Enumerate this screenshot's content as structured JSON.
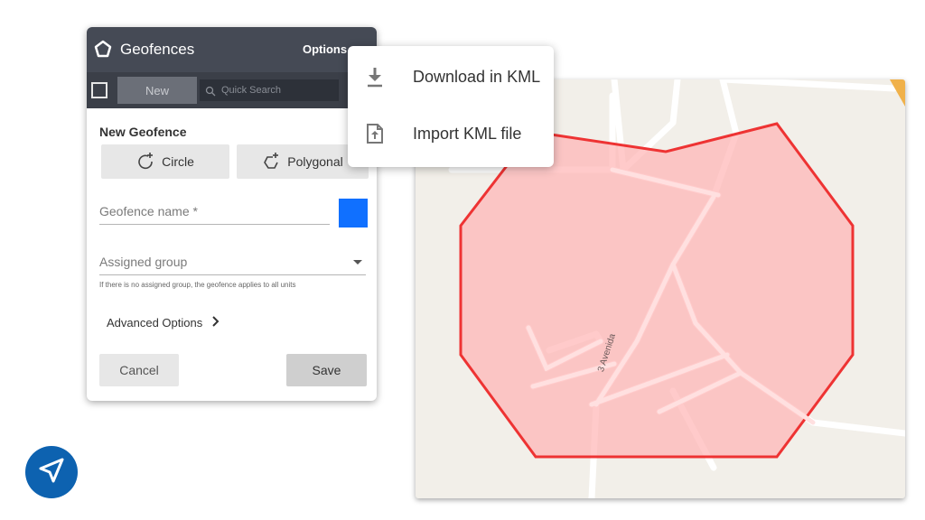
{
  "panel": {
    "title": "Geofences",
    "options_label": "Options",
    "new_label": "New",
    "search_placeholder": "Quick Search",
    "section_title": "New Geofence",
    "circle_label": "Circle",
    "polygonal_label": "Polygonal",
    "name_placeholder": "Geofence name *",
    "color": "#1070ff",
    "group_placeholder": "Assigned group",
    "group_hint": "If there is no assigned group, the geofence applies to all units",
    "advanced_label": "Advanced Options",
    "cancel_label": "Cancel",
    "save_label": "Save"
  },
  "menu": {
    "items": [
      {
        "label": "Download in KML",
        "icon": "download-icon"
      },
      {
        "label": "Import KML file",
        "icon": "file-upload-icon"
      }
    ]
  },
  "map": {
    "road_label": "3 Avenida",
    "polygon_fill": "#ffb3b3",
    "polygon_stroke": "#ee3333"
  },
  "nav": {
    "icon": "navigation-arrow-icon",
    "color": "#0d62b0"
  }
}
